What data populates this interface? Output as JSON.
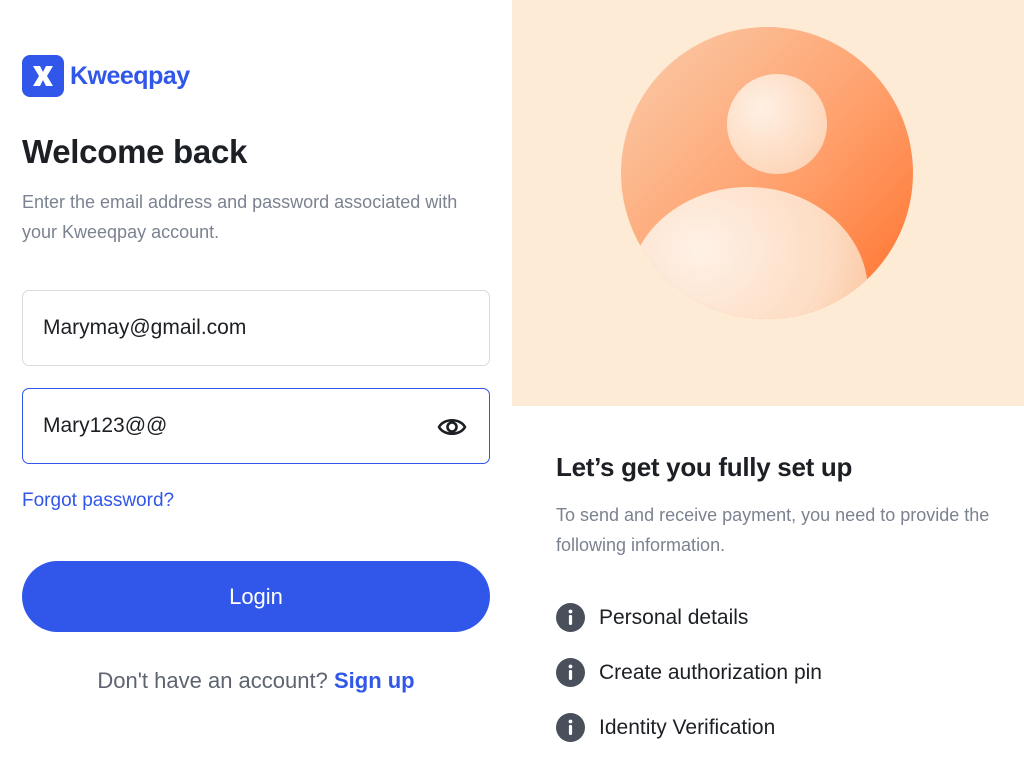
{
  "brand": {
    "name": "Kweeqpay",
    "color": "#3056ea"
  },
  "login": {
    "title": "Welcome back",
    "subtitle": "Enter the email address and password associated with your Kweeqpay account.",
    "email_value": "Marymay@gmail.com",
    "password_value": "Mary123@@",
    "forgot_label": "Forgot password?",
    "login_label": "Login",
    "signup_prompt": "Don't have an account?",
    "signup_label": "Sign up"
  },
  "setup": {
    "title": "Let’s get you fully set up",
    "description": "To send and receive payment, you need to provide the following information.",
    "items": [
      {
        "label": "Personal details",
        "icon": "info-icon"
      },
      {
        "label": "Create authorization pin",
        "icon": "info-icon"
      },
      {
        "label": "Identity Verification",
        "icon": "info-icon"
      }
    ]
  },
  "colors": {
    "accent": "#3056ea",
    "hero_bg": "#fdebd5",
    "avatar_orange": "#ff8a4c",
    "muted_text": "#7b8290"
  }
}
